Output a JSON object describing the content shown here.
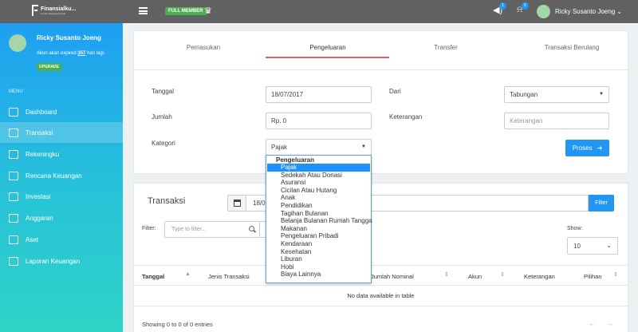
{
  "topbar": {
    "logo_text": "Finansialku...",
    "logo_sub": "Teman Keuangan Anda",
    "member_badge": "FULL MEMBER",
    "notif_count": "1",
    "bell_count": "0",
    "user_name": "Ricky Susanto Joeng",
    "user_caret": "⌄",
    "icons": [
      "menu-icon",
      "crown-icon",
      "megaphone-icon",
      "bell-icon"
    ]
  },
  "sidebar": {
    "name": "Ricky Susanto Joeng",
    "expire_prefix": "Akun akan expired",
    "expire_days": "357",
    "expire_suffix": "hari lagi.",
    "upgrade": "UPGRADE",
    "menu_title": "MENU",
    "items": [
      {
        "label": "Dashboard",
        "icon": "home-icon"
      },
      {
        "label": "Transaksi",
        "icon": "transaction-icon",
        "active": true
      },
      {
        "label": "Rekeningku",
        "icon": "bank-icon"
      },
      {
        "label": "Rencana Keuangan",
        "icon": "plan-icon"
      },
      {
        "label": "Investasi",
        "icon": "investment-icon"
      },
      {
        "label": "Anggaran",
        "icon": "budget-icon"
      },
      {
        "label": "Aset",
        "icon": "asset-icon"
      },
      {
        "label": "Laporan Keuangan",
        "icon": "folder-icon"
      }
    ]
  },
  "tabs": [
    "Pemasukan",
    "Pengeluaran",
    "Transfer",
    "Transaksi Berulang"
  ],
  "active_tab": "Pengeluaran",
  "form": {
    "tanggal_label": "Tanggal",
    "tanggal_value": "18/07/2017",
    "jumlah_label": "Jumlah",
    "jumlah_value": "Rp. 0",
    "kategori_label": "Kategori",
    "kategori_value": "Pajak",
    "dari_label": "Dari",
    "dari_value": "Tabungan",
    "keterangan_label": "Keterangan",
    "keterangan_placeholder": "Keterangan",
    "proses": "Proses",
    "proses_arrow": "➔"
  },
  "dropdown": {
    "group": "Pengeluaran",
    "options": [
      "Pajak",
      "Sedekah Atau Donasi",
      "Asuransi",
      "Cicilan Atau Hutang",
      "Anak",
      "Pendidikan",
      "Tagihan Bulanan",
      "Belanja Bulanan Rumah Tangga",
      "Makanan",
      "Pengeluaran Pribadi",
      "Kendaraan",
      "Kesehatan",
      "Liburan",
      "Hobi",
      "Biaya Lainnya"
    ],
    "selected": "Pajak"
  },
  "transaksi": {
    "title": "Transaksi",
    "date_range": "18/07",
    "filter_button": "Filter",
    "filter_label": "Filter:",
    "type_placeholder": "Type to filter...",
    "show_label": "Show:",
    "show_value": "10",
    "columns": [
      "Tanggal",
      "Jenis Transaksi",
      "Jumlah Nominal",
      "Akun",
      "Keterangan",
      "Pilihan"
    ],
    "no_data": "No data available in table",
    "showing": "Showing 0 to 0 of 0 entries",
    "prev": "←",
    "next": "→"
  },
  "colors": {
    "topbar": "#616161",
    "sidebar_top": "#1e9ff2",
    "sidebar_bottom": "#2fd3c6",
    "accent": "#2196f3",
    "member_badge": "#4caf50",
    "tab_underline": "#e8636c"
  }
}
